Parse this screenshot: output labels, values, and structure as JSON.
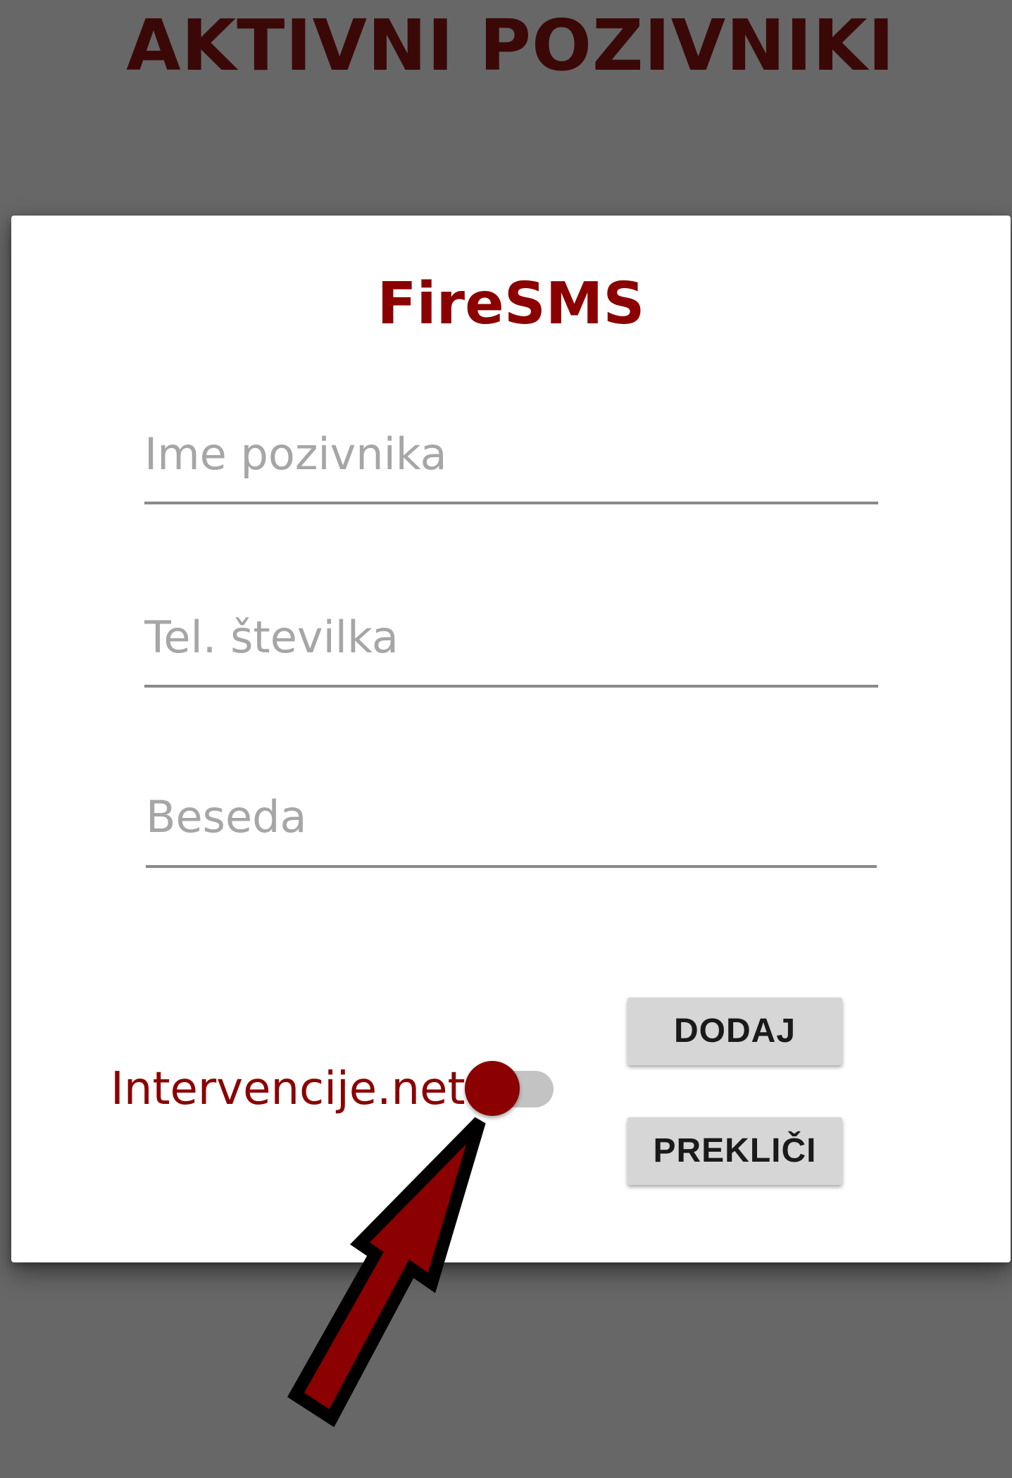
{
  "header": {
    "title": "AKTIVNI POZIVNIKI"
  },
  "dialog": {
    "title": "FireSMS",
    "fields": {
      "name": {
        "placeholder": "Ime pozivnika",
        "value": ""
      },
      "phone": {
        "placeholder": "Tel. številka",
        "value": ""
      },
      "word": {
        "placeholder": "Beseda",
        "value": ""
      }
    },
    "toggle": {
      "label": "Intervencije.net",
      "state": "off"
    },
    "buttons": {
      "add_label": "DODAJ",
      "cancel_label": "PREKLIČI"
    }
  },
  "annotation": {
    "icon": "arrow-pointer-icon",
    "color": "#8b0000"
  },
  "colors": {
    "accent": "#8b0000",
    "backdrop": "#676767",
    "header_text": "#3b0808"
  }
}
